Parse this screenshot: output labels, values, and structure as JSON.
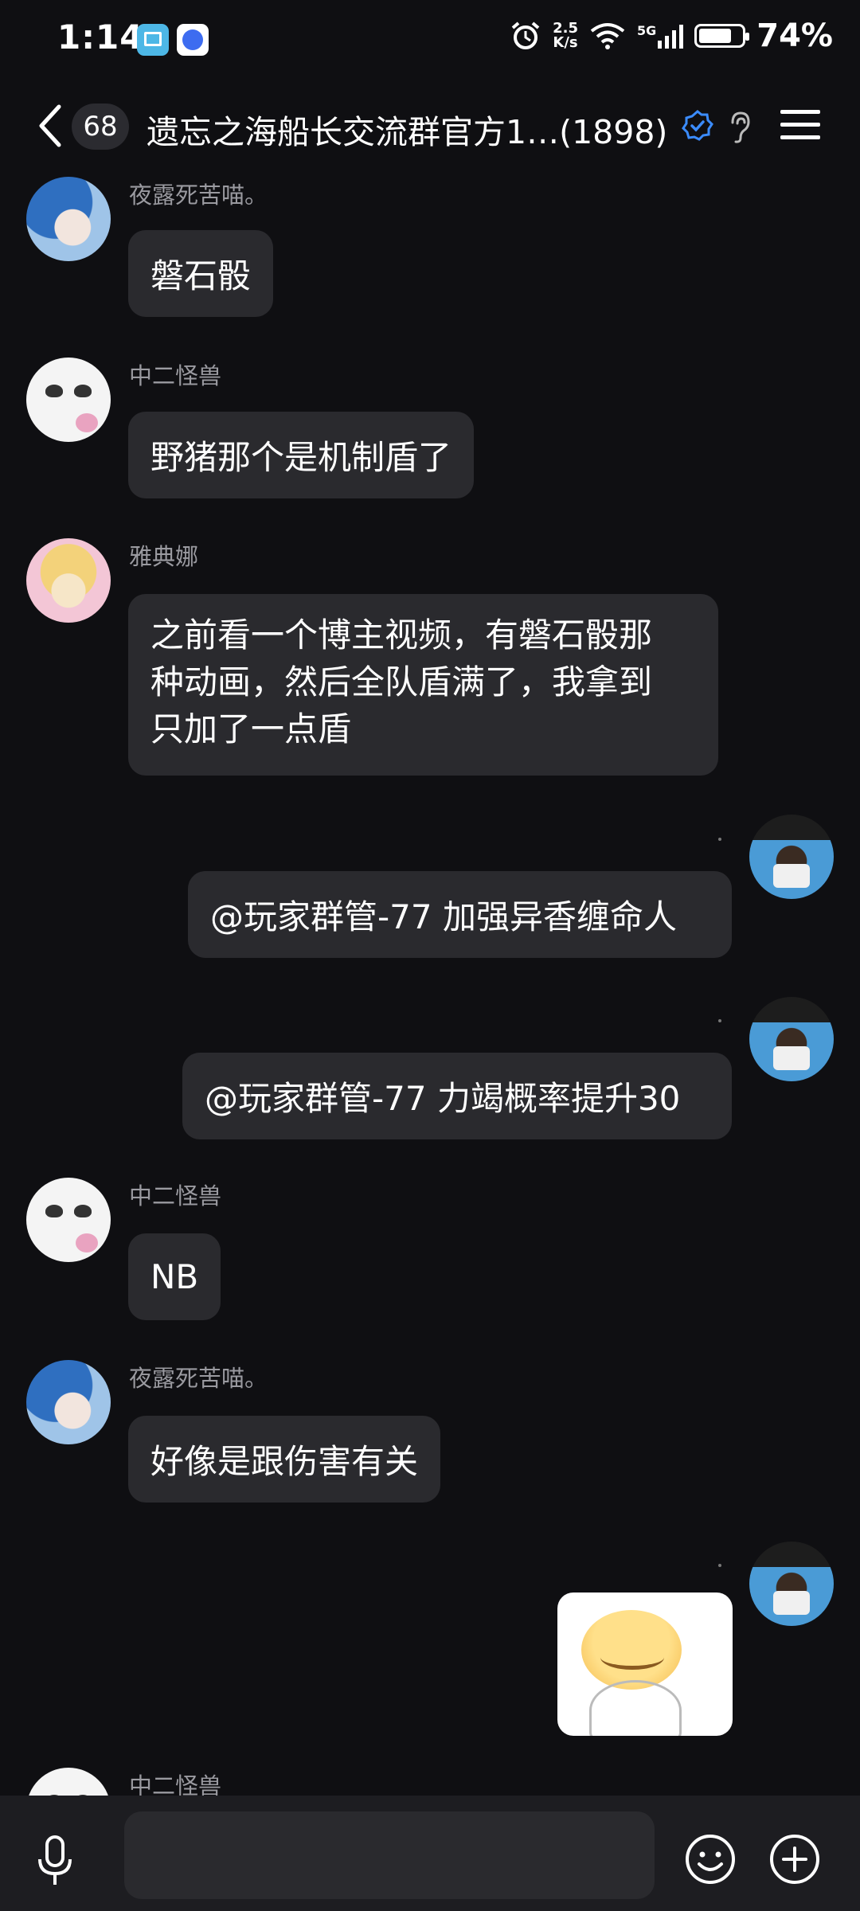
{
  "status_bar": {
    "time": "1:14",
    "net_speed_value": "2.5",
    "net_speed_unit": "K/s",
    "network": "5G",
    "battery": "74%"
  },
  "header": {
    "unread_count": "68",
    "title": "遗忘之海船长交流群官方1…(1898)"
  },
  "messages": [
    {
      "sender": "夜露死苦喵。",
      "text": "磐石骰"
    },
    {
      "sender": "中二怪兽",
      "text": "野猪那个是机制盾了"
    },
    {
      "sender": "雅典娜",
      "lines": [
        "之前看一个博主视频，有磐石骰那",
        "种动画，然后全队盾满了，我拿到",
        "只加了一点盾"
      ]
    },
    {
      "sender": "",
      "text": "@玩家群管-77 加强异香缠命人"
    },
    {
      "sender": "",
      "text": "@玩家群管-77 力竭概率提升30"
    },
    {
      "sender": "中二怪兽",
      "text": "NB"
    },
    {
      "sender": "夜露死苦喵。",
      "text": "好像是跟伤害有关"
    },
    {
      "sender": "",
      "sticker": "smiling-face-sticker"
    },
    {
      "sender": "中二怪兽",
      "text": ""
    }
  ],
  "input": {
    "placeholder": ""
  }
}
